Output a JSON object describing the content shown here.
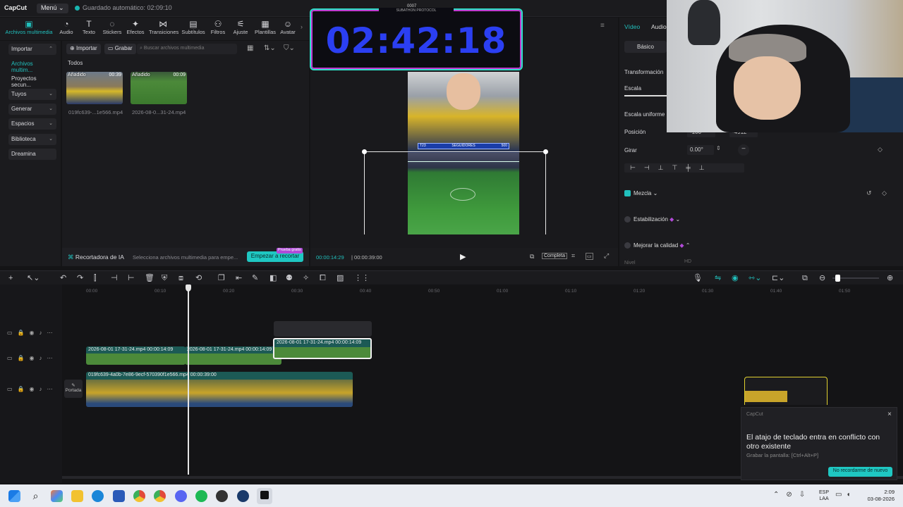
{
  "titlebar": {
    "logo": "CapCut",
    "menu": "Menú",
    "autosave": "Guardado automático: 02:09:10"
  },
  "toolbar": {
    "items": [
      {
        "label": "Archivos multimedia",
        "icon": "media-icon"
      },
      {
        "label": "Audio",
        "icon": "audio-icon"
      },
      {
        "label": "Texto",
        "icon": "text-icon"
      },
      {
        "label": "Stickers",
        "icon": "sticker-icon"
      },
      {
        "label": "Efectos",
        "icon": "effects-icon"
      },
      {
        "label": "Transiciones",
        "icon": "transition-icon"
      },
      {
        "label": "Subtítulos",
        "icon": "subtitles-icon"
      },
      {
        "label": "Filtros",
        "icon": "filter-icon"
      },
      {
        "label": "Ajuste",
        "icon": "adjust-icon"
      },
      {
        "label": "Plantillas",
        "icon": "templates-icon"
      },
      {
        "label": "Avatar",
        "icon": "avatar-icon"
      }
    ]
  },
  "leftnav": {
    "items": [
      {
        "label": "Importar"
      },
      {
        "label": "Archivos multim..."
      },
      {
        "label": "Proyectos secun..."
      },
      {
        "label": "Tuyos"
      },
      {
        "label": "Generar"
      },
      {
        "label": "Espacios"
      },
      {
        "label": "Biblioteca"
      },
      {
        "label": "Dreamina"
      }
    ]
  },
  "media": {
    "import_label": "Importar",
    "record_label": "Grabar",
    "search_placeholder": "Buscar archivos multimedia",
    "filter_all": "Todos",
    "items": [
      {
        "tag": "Añadido",
        "duration": "00:39",
        "name": "019fc639-...1e566.mp4"
      },
      {
        "tag": "Añadido",
        "duration": "00:09",
        "name": "2026-08-0...31-24.mp4"
      }
    ],
    "ai_title": "Recortadora de IA",
    "ai_text": "Selecciona archivos multimedia para empe...",
    "ai_button": "Empezar a recortar",
    "ai_badge": "Prueba gratis"
  },
  "preview": {
    "timer": "02:42:18",
    "timer_top": "SUBATHON PROTOCOL",
    "timer_small": "0007",
    "current_time": "00:00:14:29",
    "total_time": "00:00:39:00",
    "quality": "Completa",
    "seguidores_label": "SEGUIDORES",
    "seguidores_left": "T23",
    "seguidores_right": "500"
  },
  "rightpanel": {
    "tab_video": "Vídeo",
    "tab_audio": "Audio",
    "basic": "Básico",
    "transform": "Transformación",
    "scale": "Escala",
    "uniform_scale": "Escala uniforme",
    "position": "Posición",
    "pos_x": "-100",
    "pos_y": "-4912",
    "rotate": "Girar",
    "rotate_value": "0.00°",
    "blend": "Mezcla",
    "stabilization": "Estabilización",
    "quality": "Mejorar la calidad",
    "level_label": "Nivel",
    "level_value": "HD"
  },
  "timeline": {
    "ticks": [
      "00:00",
      "00:10",
      "00:20",
      "00:30",
      "00:40",
      "00:50",
      "01:00",
      "01:10",
      "01:20",
      "01:30",
      "01:40",
      "01:50"
    ],
    "clips": [
      {
        "label": "2026-08-01 17-31-24.mp4  00:00:14:09"
      },
      {
        "label": "2026-08-01 17-31-24.mp4  00:00:14:09"
      },
      {
        "label": "2026-08-01 17-31-24.mp4  00:00:14:09"
      },
      {
        "label": "019fc639-4a0b-7e86-9ecf-570390f1e566.mp4  00:00:39:00"
      }
    ],
    "cover_label": "Portada"
  },
  "toast": {
    "app": "CapCut",
    "title": "El atajo de teclado entra en conflicto con otro existente",
    "detail": "Grabar la pantalla: [Ctrl+Alt+P]",
    "button": "No recordarme de nuevo"
  },
  "taskbar": {
    "lang": "ESP",
    "layout": "LAA",
    "time": "2:09",
    "date": "03-08-2026"
  },
  "colors": {
    "accent": "#21c0bd",
    "timer": "#2a3df0"
  }
}
